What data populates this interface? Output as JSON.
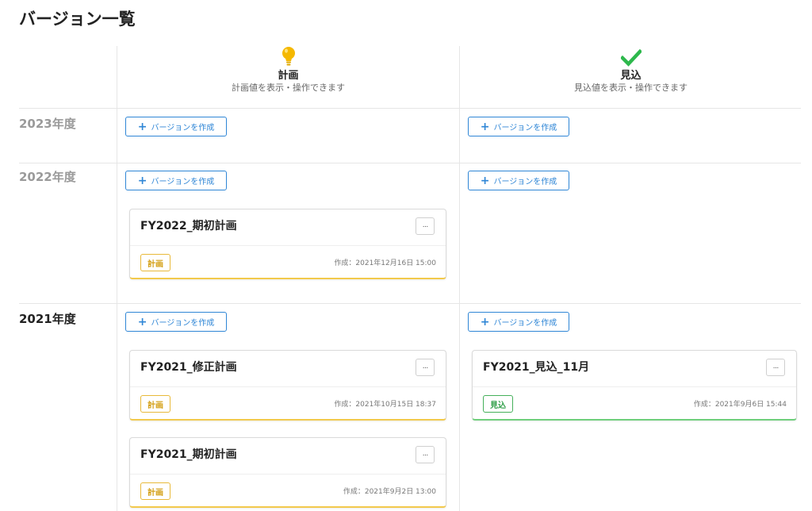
{
  "page": {
    "title": "バージョン一覧"
  },
  "columns": {
    "plan": {
      "title": "計画",
      "subtitle": "計画値を表示・操作できます",
      "icon": "lightbulb-icon",
      "color": "#f5b800"
    },
    "forecast": {
      "title": "見込",
      "subtitle": "見込値を表示・操作できます",
      "icon": "checkmark-icon",
      "color": "#2db84c"
    }
  },
  "create_button_label": "バージョンを作成",
  "more_button_label": "···",
  "years": [
    {
      "label": "2023年度"
    },
    {
      "label": "2022年度"
    },
    {
      "label": "2021年度"
    }
  ],
  "versions": {
    "fy2022_plan_initial": {
      "name": "FY2022_期初計画",
      "badge": "計画",
      "created": "作成：2021年12月16日 15:00"
    },
    "fy2021_plan_revised": {
      "name": "FY2021_修正計画",
      "badge": "計画",
      "created": "作成：2021年10月15日 18:37"
    },
    "fy2021_plan_initial": {
      "name": "FY2021_期初計画",
      "badge": "計画",
      "created": "作成：2021年9月2日 13:00"
    },
    "fy2021_forecast_nov": {
      "name": "FY2021_見込_11月",
      "badge": "見込",
      "created": "作成：2021年9月6日 15:44"
    }
  }
}
